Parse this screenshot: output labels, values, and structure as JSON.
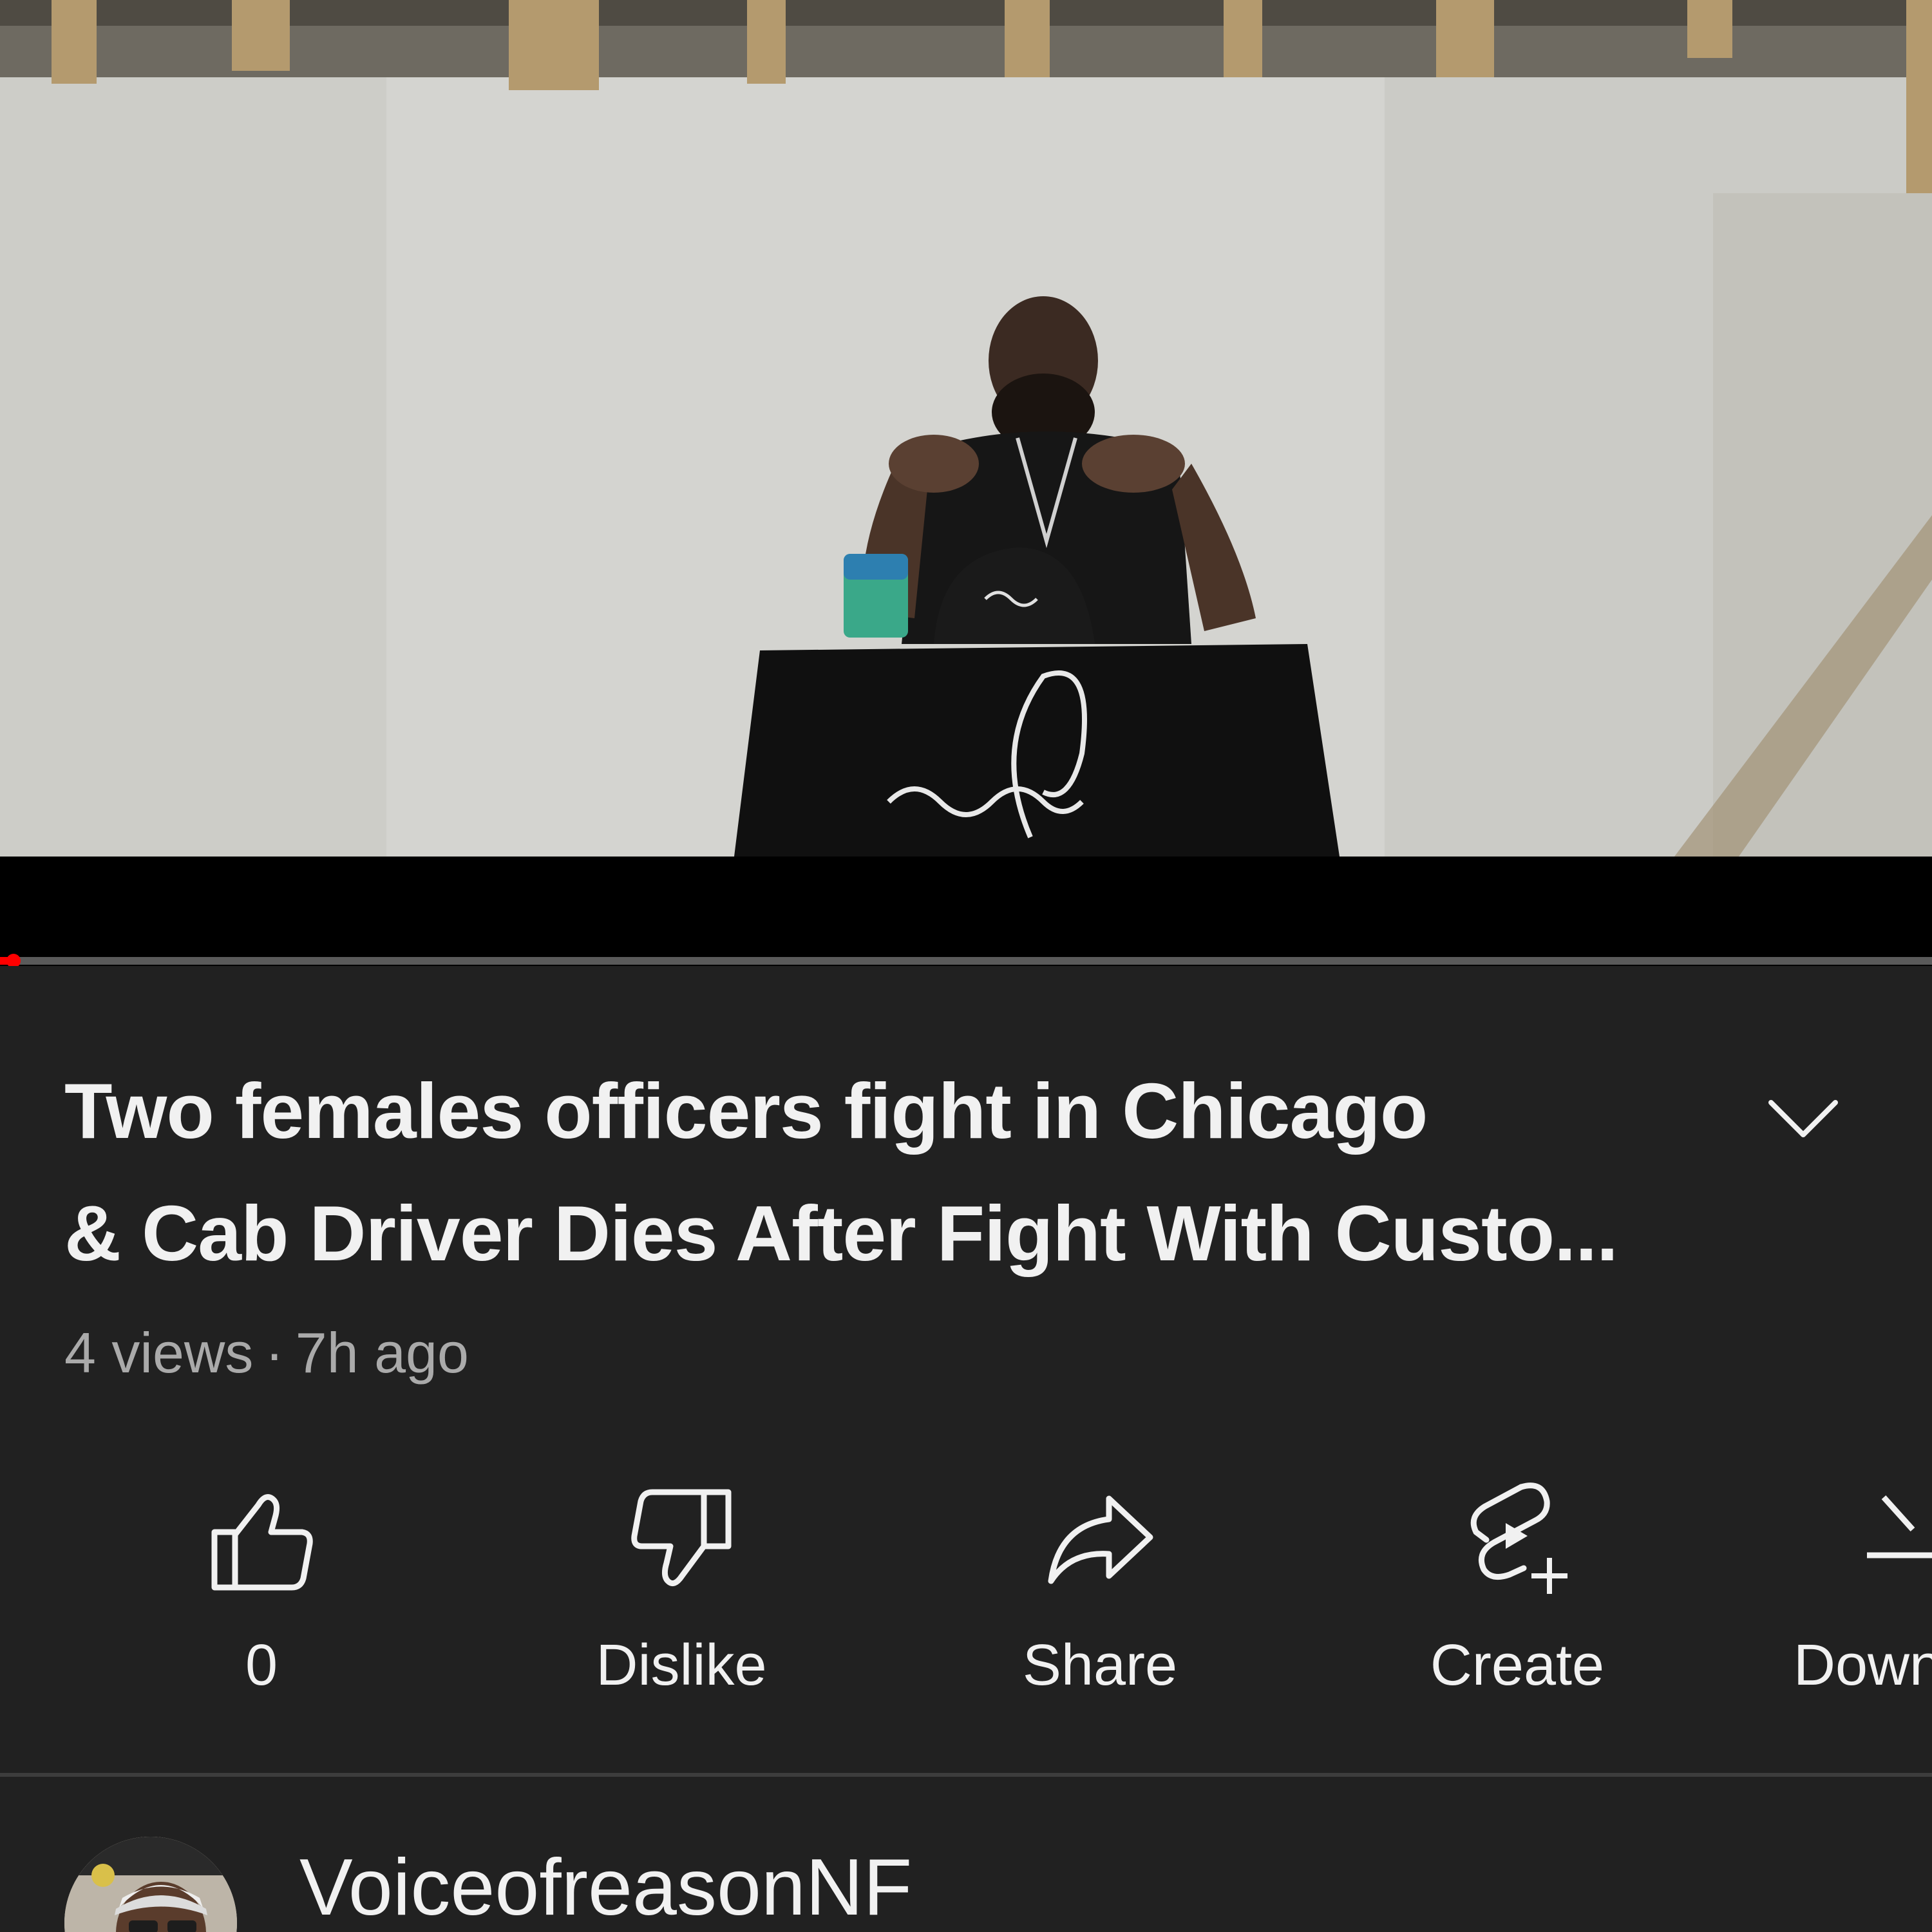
{
  "video": {
    "progress_fraction": 0.007,
    "progress_color": "#ff0000"
  },
  "title": {
    "line1": "Two females officers fight in Chicago",
    "line2": "& Cab Driver Dies After Fight With Custo..."
  },
  "meta": {
    "views": "4 views",
    "separator": "·",
    "age": "7h ago"
  },
  "actions": {
    "like": {
      "label": "0",
      "icon": "thumbs-up-icon"
    },
    "dislike": {
      "label": "Dislike",
      "icon": "thumbs-down-icon"
    },
    "share": {
      "label": "Share",
      "icon": "share-arrow-icon"
    },
    "create": {
      "label": "Create",
      "icon": "create-shorts-icon"
    },
    "download": {
      "label": "Down",
      "icon": "download-icon"
    }
  },
  "channel": {
    "name": "VoiceofreasonNF",
    "avatar_icon": "channel-avatar"
  },
  "colors": {
    "background": "#212121",
    "text_primary": "#f1f1f1",
    "text_secondary": "#aaaaaa"
  }
}
